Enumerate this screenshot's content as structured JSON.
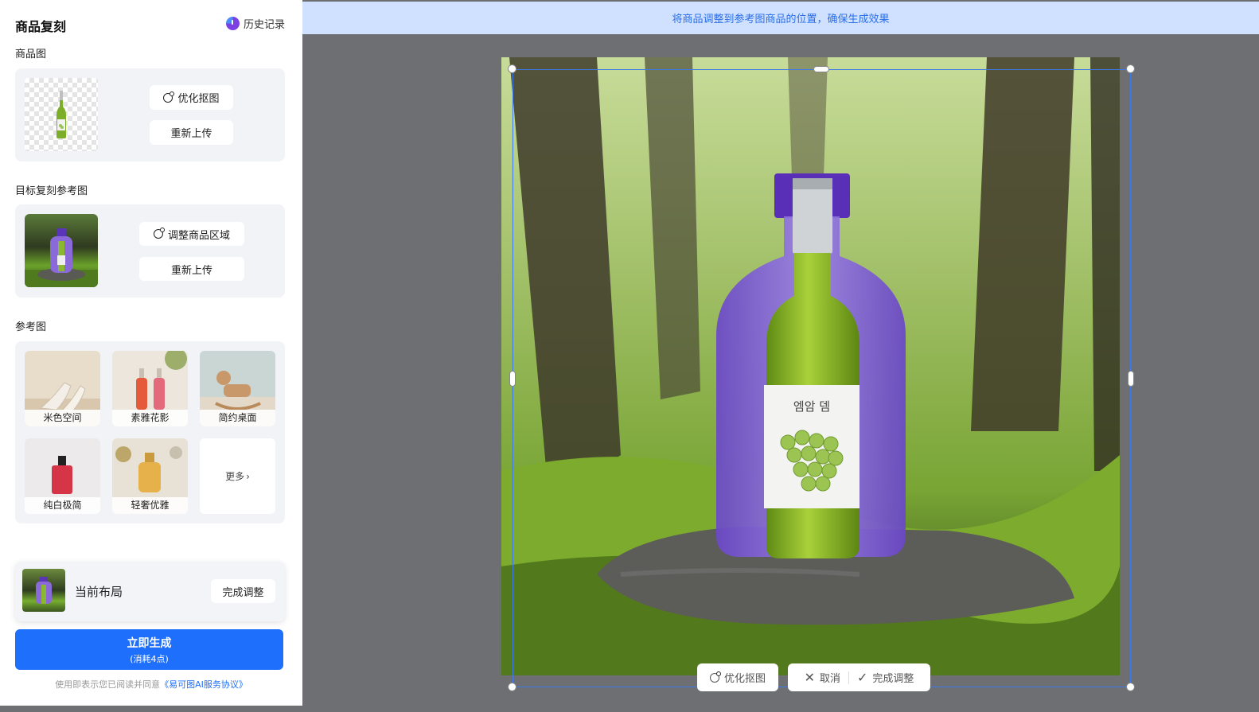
{
  "header": {
    "title": "商品复刻",
    "history_label": "历史记录"
  },
  "product_section": {
    "label": "商品图",
    "optimize_label": "优化抠图",
    "reupload_label": "重新上传"
  },
  "target_section": {
    "label": "目标复刻参考图",
    "adjust_label": "调整商品区域",
    "reupload_label": "重新上传"
  },
  "reference_section": {
    "label": "参考图",
    "items": [
      {
        "label": "米色空间",
        "icon": "high-heel-shoe"
      },
      {
        "label": "素雅花影",
        "icon": "bottles-with-flowers"
      },
      {
        "label": "简约桌面",
        "icon": "wooden-rocking-horse"
      },
      {
        "label": "纯白极简",
        "icon": "red-perfume"
      },
      {
        "label": "轻奢优雅",
        "icon": "gold-perfume"
      }
    ],
    "more_label": "更多"
  },
  "layout": {
    "text": "当前布局",
    "button_label": "完成调整"
  },
  "generate": {
    "main": "立即生成",
    "sub": "(消耗4点)"
  },
  "agreement": {
    "prefix": "使用即表示您已阅读并同意",
    "link": "《易可图AI服务协议》"
  },
  "banner": {
    "text": "将商品调整到参考图商品的位置，确保生成效果"
  },
  "toolbar": {
    "optimize_label": "优化抠图",
    "cancel_label": "取消",
    "done_label": "完成调整"
  },
  "colors": {
    "accent": "#1e6ffb",
    "banner_bg": "#cfe1ff",
    "banner_text": "#2b6ee8",
    "frame": "#3b7ae8"
  }
}
